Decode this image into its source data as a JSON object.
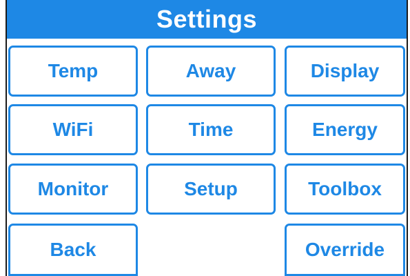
{
  "header": {
    "title": "Settings"
  },
  "colors": {
    "accent": "#1e88e5",
    "background": "#ffffff",
    "frame": "#1a1a1a"
  },
  "buttons": {
    "temp": "Temp",
    "away": "Away",
    "display": "Display",
    "wifi": "WiFi",
    "time": "Time",
    "energy": "Energy",
    "monitor": "Monitor",
    "setup": "Setup",
    "toolbox": "Toolbox",
    "back": "Back",
    "override": "Override"
  }
}
